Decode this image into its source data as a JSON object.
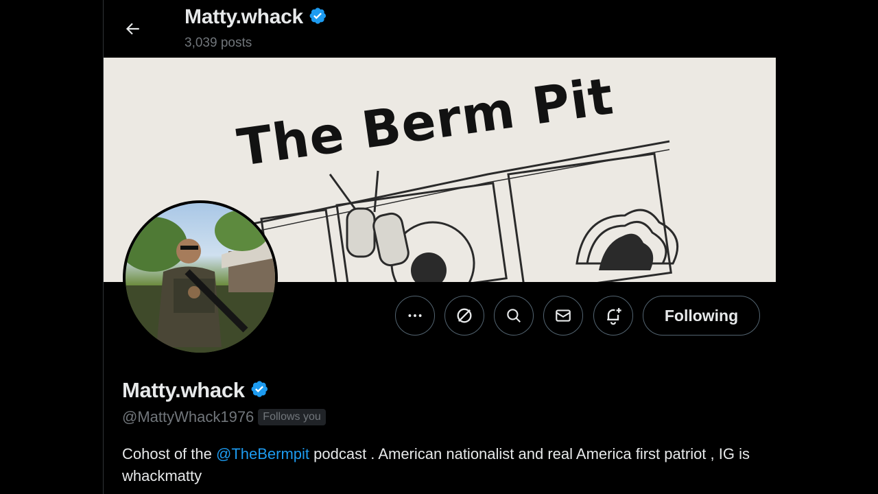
{
  "header": {
    "display_name": "Matty.whack",
    "posts_count": "3,039 posts"
  },
  "banner": {
    "text": "The Berm Pit"
  },
  "actions": {
    "more_icon": "more-horizontal-icon",
    "grok_icon": "grok-icon",
    "search_icon": "search-icon",
    "message_icon": "mail-icon",
    "notify_icon": "bell-plus-icon",
    "following_label": "Following"
  },
  "profile": {
    "display_name": "Matty.whack",
    "handle": "@MattyWhack1976",
    "follows_you": "Follows you",
    "bio_prefix": "Cohost of the ",
    "bio_mention": "@TheBermpit",
    "bio_suffix": " podcast . American nationalist and real America first patriot , IG is whackmatty"
  },
  "colors": {
    "background": "#000000",
    "text": "#e7e9ea",
    "muted": "#71767b",
    "accent": "#1d9bf0",
    "border": "#536471"
  }
}
